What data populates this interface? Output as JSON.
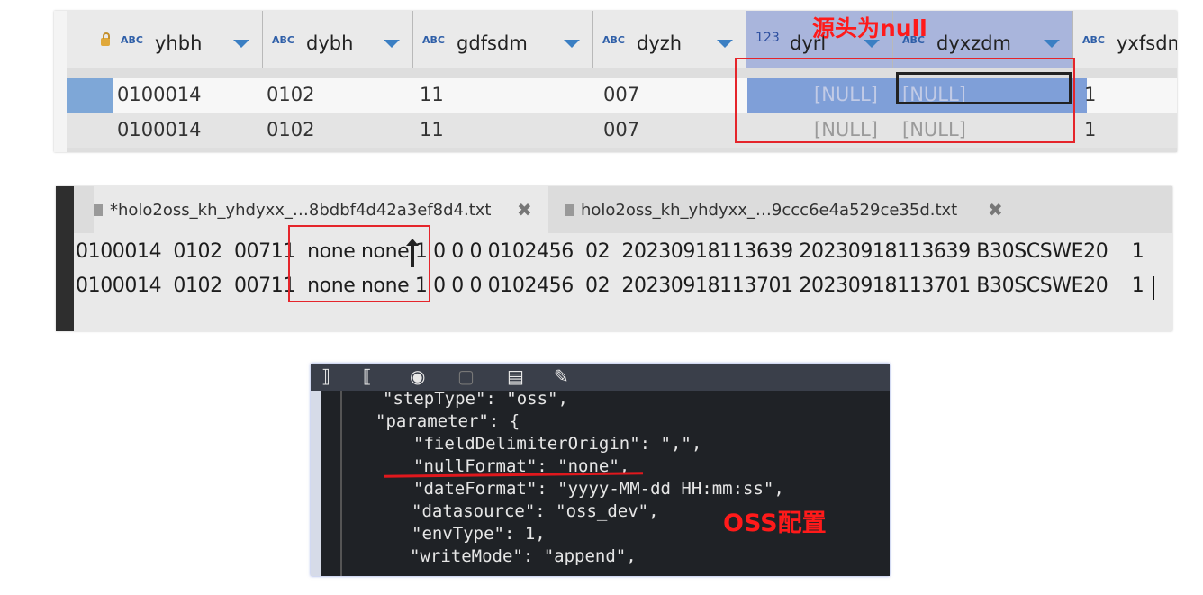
{
  "db_grid": {
    "columns": [
      {
        "type": "ABC",
        "name": "yhbh"
      },
      {
        "type": "ABC",
        "name": "dybh"
      },
      {
        "type": "ABC",
        "name": "gdfsdm"
      },
      {
        "type": "ABC",
        "name": "dyzh"
      },
      {
        "type": "123",
        "name": "dyrl"
      },
      {
        "type": "ABC",
        "name": "dyxzdm"
      },
      {
        "type": "ABC",
        "name": "yxfsdm"
      }
    ],
    "rows": [
      [
        "0100014",
        "0102",
        "11",
        "007",
        "[NULL]",
        "[NULL]",
        "1"
      ],
      [
        "0100014",
        "0102",
        "11",
        "007",
        "[NULL]",
        "[NULL]",
        "1"
      ]
    ],
    "annotation": "源头为null"
  },
  "editor": {
    "tabs": [
      {
        "label": "*holo2oss_kh_yhdyxx_…8bdbf4d42a3ef8d4.txt"
      },
      {
        "label": "holo2oss_kh_yhdyxx_…9ccc6e4a529ce35d.txt"
      }
    ],
    "close_glyph": "✖",
    "lines": [
      {
        "pre": "0100014  0102  00711  ",
        "boxed": "none none",
        "post": " 1 0 0 0 0102456  02  20230918113639 20230918113639 B30SCSWE20    1"
      },
      {
        "pre": "0100014  0102  00711  ",
        "boxed": "none none",
        "post": " 1 0 0 0 0102456  02  20230918113701 20230918113701 B30SCSWE20    1"
      }
    ]
  },
  "config": {
    "toolbar_icons": [
      "bracket-icon",
      "format-icon",
      "record-icon",
      "lock-icon",
      "doc-edit-icon",
      "magic-wand-icon"
    ],
    "lines": [
      "\"stepType\": \"oss\",",
      "\"parameter\": {",
      "\"fieldDelimiterOrigin\": \",\",",
      "\"nullFormat\": \"none\",",
      "\"dateFormat\": \"yyyy-MM-dd HH:mm:ss\",",
      "\"datasource\": \"oss_dev\",",
      "\"envType\": 1,",
      "\"writeMode\": \"append\","
    ],
    "annotation": "OSS配置"
  },
  "colors": {
    "annotation_red": "#ff1a1a",
    "selection_blue": "#7f9fd8",
    "type_blue": "#2f5fa8"
  }
}
